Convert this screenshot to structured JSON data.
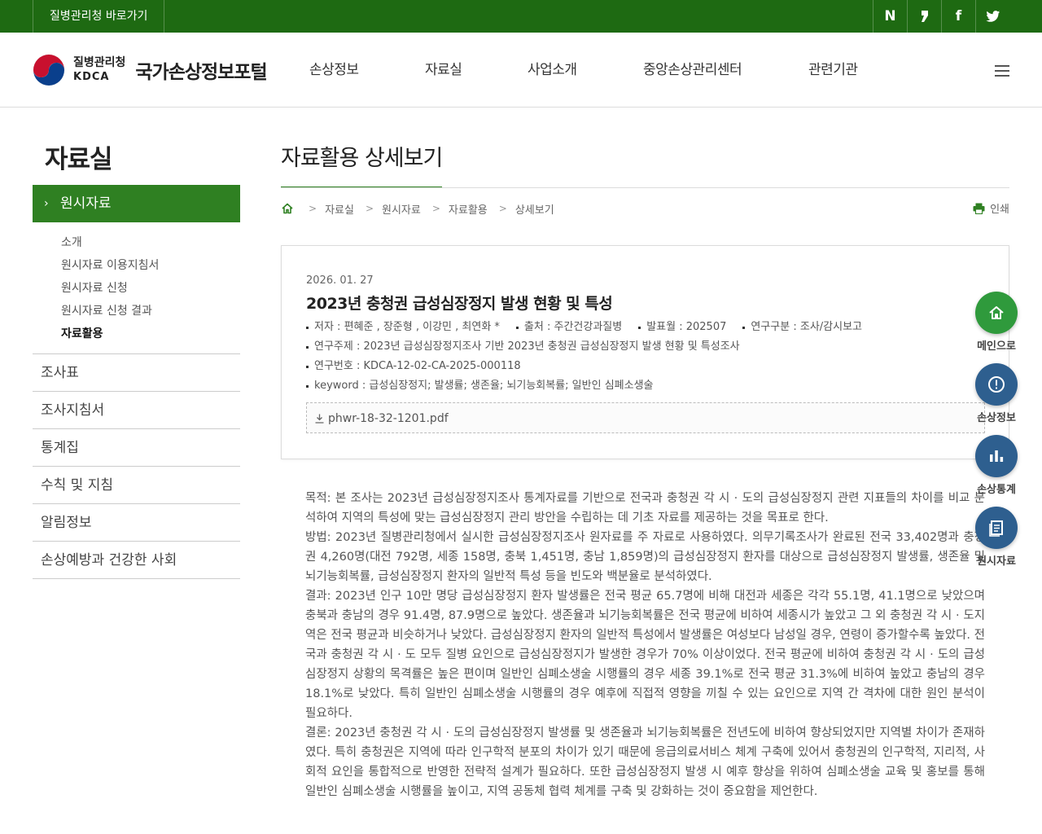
{
  "topbar": {
    "link": "질병관리청 바로가기",
    "sns": [
      {
        "icon": "naver-blog-icon",
        "glyph": "N"
      },
      {
        "icon": "kakao-story-icon",
        "glyph": "❜"
      },
      {
        "icon": "facebook-icon",
        "glyph": "f"
      },
      {
        "icon": "twitter-icon",
        "glyph": "🐦"
      }
    ]
  },
  "header": {
    "org_ko": "질병관리청",
    "org_en": "KDCA",
    "site_name": "국가손상정보포털",
    "gnb": [
      "손상정보",
      "자료실",
      "사업소개",
      "중앙손상관리센터",
      "관련기관"
    ]
  },
  "sidebar": {
    "title": "자료실",
    "active": "원시자료",
    "sub_items": [
      "소개",
      "원시자료 이용지침서",
      "원시자료 신청",
      "원시자료 신청 결과",
      "자료활용"
    ],
    "current_sub": 4,
    "items": [
      "조사표",
      "조사지침서",
      "통계집",
      "수칙 및 지침",
      "알림정보",
      "손상예방과 건강한 사회"
    ]
  },
  "content": {
    "page_title": "자료활용 상세보기",
    "breadcrumb": [
      "자료실",
      "원시자료",
      "자료활용",
      "상세보기"
    ],
    "print_label": "인쇄",
    "date": "2026. 01. 27",
    "doc_title": "2023년 충청권 급성심장정지 발생 현황 및 특성",
    "meta": {
      "author": "저자 : 편혜준 , 장준형 , 이강민 , 최연화 *",
      "source": "출처 : 주간건강과질병",
      "published": "발표월 : 202507",
      "category": "연구구분 : 조사/감시보고",
      "topic": "연구주제 : 2023년 급성심장정지조사 기반 2023년 충청권 급성심장정지 발생 현황 및 특성조사",
      "number": "연구번호 : KDCA-12-02-CA-2025-000118",
      "keyword": "keyword : 급성심장정지; 발생률; 생존율; 뇌기능회복률; 일반인 심폐소생술"
    },
    "file_name": "phwr-18-32-1201.pdf",
    "body": [
      "목적: 본 조사는 2023년 급성심장정지조사 통계자료를 기반으로 전국과 충청권 각 시 · 도의 급성심장정지 관련 지표들의 차이를 비교 분석하여 지역의 특성에 맞는 급성심장정지 관리 방안을 수립하는 데 기초 자료를 제공하는 것을 목표로 한다.",
      "방법: 2023년 질병관리청에서 실시한 급성심장정지조사 원자료를 주 자료로 사용하였다. 의무기록조사가 완료된 전국 33,402명과 충청권 4,260명(대전 792명, 세종 158명, 충북 1,451명, 충남 1,859명)의 급성심장정지 환자를 대상으로 급성심장정지 발생률, 생존율 및 뇌기능회복률, 급성심장정지 환자의 일반적 특성 등을 빈도와 백분율로 분석하였다.",
      "결과: 2023년 인구 10만 명당 급성심장정지 환자 발생률은 전국 평균 65.7명에 비해 대전과 세종은 각각 55.1명, 41.1명으로 낮았으며 충북과 충남의 경우 91.4명, 87.9명으로 높았다. 생존율과 뇌기능회복률은 전국 평균에 비하여 세종시가 높았고 그 외 충청권 각 시 · 도지역은 전국 평균과 비슷하거나 낮았다. 급성심장정지 환자의 일반적 특성에서 발생률은 여성보다 남성일 경우, 연령이 증가할수록 높았다. 전국과 충청권 각 시 · 도 모두 질병 요인으로 급성심장정지가 발생한 경우가 70% 이상이었다. 전국 평균에 비하여 충청권 각 시 · 도의 급성심장정지 상황의 목격률은 높은 편이며 일반인 심폐소생술 시행률의 경우 세종 39.1%로 전국 평균 31.3%에 비하여 높았고 충남의 경우 18.1%로 낮았다. 특히 일반인 심폐소생술 시행률의 경우 예후에 직접적 영향을 끼칠 수 있는 요인으로 지역 간 격차에 대한 원인 분석이 필요하다.",
      "결론: 2023년 충청권 각 시 · 도의 급성심장정지 발생률 및 생존율과 뇌기능회복률은 전년도에 비하여 향상되었지만 지역별 차이가 존재하였다. 특히 충청권은 지역에 따라 인구학적 분포의 차이가 있기 때문에 응급의료서비스 체계 구축에 있어서 충청권의 인구학적, 지리적, 사회적 요인을 통합적으로 반영한 전략적 설계가 필요하다. 또한 급성심장정지 발생 시 예후 향상을 위하여 심폐소생술 교육 및 홍보를 통해 일반인 심폐소생술 시행률을 높이고, 지역 공동체 협력 체계를 구축 및 강화하는 것이 중요함을 제언한다."
    ]
  },
  "quick_menu": [
    {
      "label": "메인으로",
      "icon": "home-icon",
      "color": "#2f9a3c"
    },
    {
      "label": "손상정보",
      "icon": "info-icon",
      "color": "#2e5f8f"
    },
    {
      "label": "손상통계",
      "icon": "bar-chart-icon",
      "color": "#2e5f8f"
    },
    {
      "label": "원시자료",
      "icon": "document-icon",
      "color": "#2e5f8f"
    }
  ],
  "colors": {
    "topbar": "#1e6a12",
    "accent": "#2f8022",
    "quick_blue": "#2e5f8f",
    "quick_green": "#2f9a3c"
  }
}
